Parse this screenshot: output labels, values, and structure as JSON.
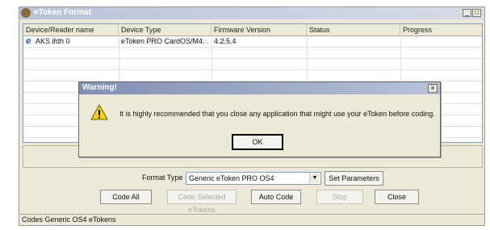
{
  "window": {
    "title": "eToken Format",
    "minimize_glyph": "_",
    "maximize_glyph": "□"
  },
  "table": {
    "columns": [
      "Device/Reader name",
      "Device Type",
      "Firmware Version",
      "Status",
      "Progress"
    ],
    "rows": [
      {
        "icon": "smartcard-reader-icon",
        "reader": "AKS ifdh 0",
        "type": "eToken PRO CardOS/M4. .",
        "firmware": "4.2.5.4",
        "status": "",
        "progress": ""
      }
    ]
  },
  "format": {
    "label": "Format Type",
    "selected": "Generic eToken PRO OS4",
    "set_parameters": "Set Parameters"
  },
  "buttons": {
    "code_all": "Code All",
    "code_selected": "Code Selected eTokens",
    "auto_code": "Auto Code",
    "stop": "Stop",
    "close": "Close"
  },
  "status_text": "Codes Generic OS4 eTokens",
  "dialog": {
    "title": "Warning!",
    "close_glyph": "×",
    "message": "It is highly recommended that you close any application that might use your eToken before coding.",
    "ok_label": "OK"
  }
}
